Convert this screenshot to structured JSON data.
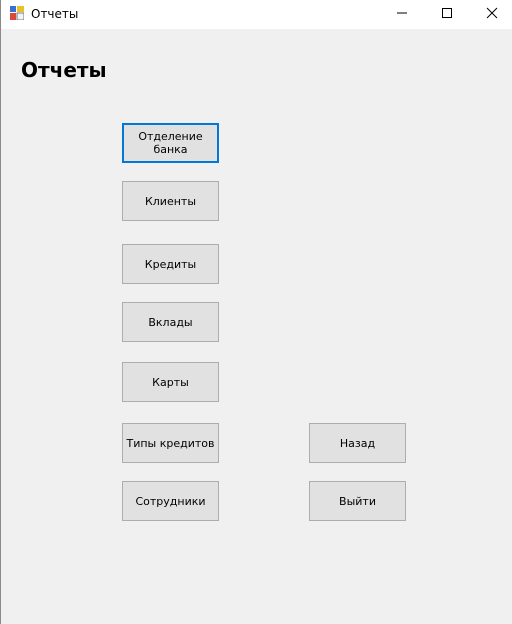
{
  "window": {
    "title": "Отчеты",
    "icons": [
      "app-icon",
      "minimize-icon",
      "maximize-icon",
      "close-icon"
    ]
  },
  "form": {
    "heading": "Отчеты"
  },
  "buttons": {
    "bank_branch": "Отделение\nбанка",
    "clients": "Клиенты",
    "credits": "Кредиты",
    "deposits": "Вклады",
    "cards": "Карты",
    "credit_types": "Типы кредитов",
    "employees": "Сотрудники",
    "back": "Назад",
    "exit": "Выйти"
  },
  "colors": {
    "focus_border": "#0078d7",
    "button_face": "#e1e1e1",
    "form_background": "#f0f0f0"
  }
}
